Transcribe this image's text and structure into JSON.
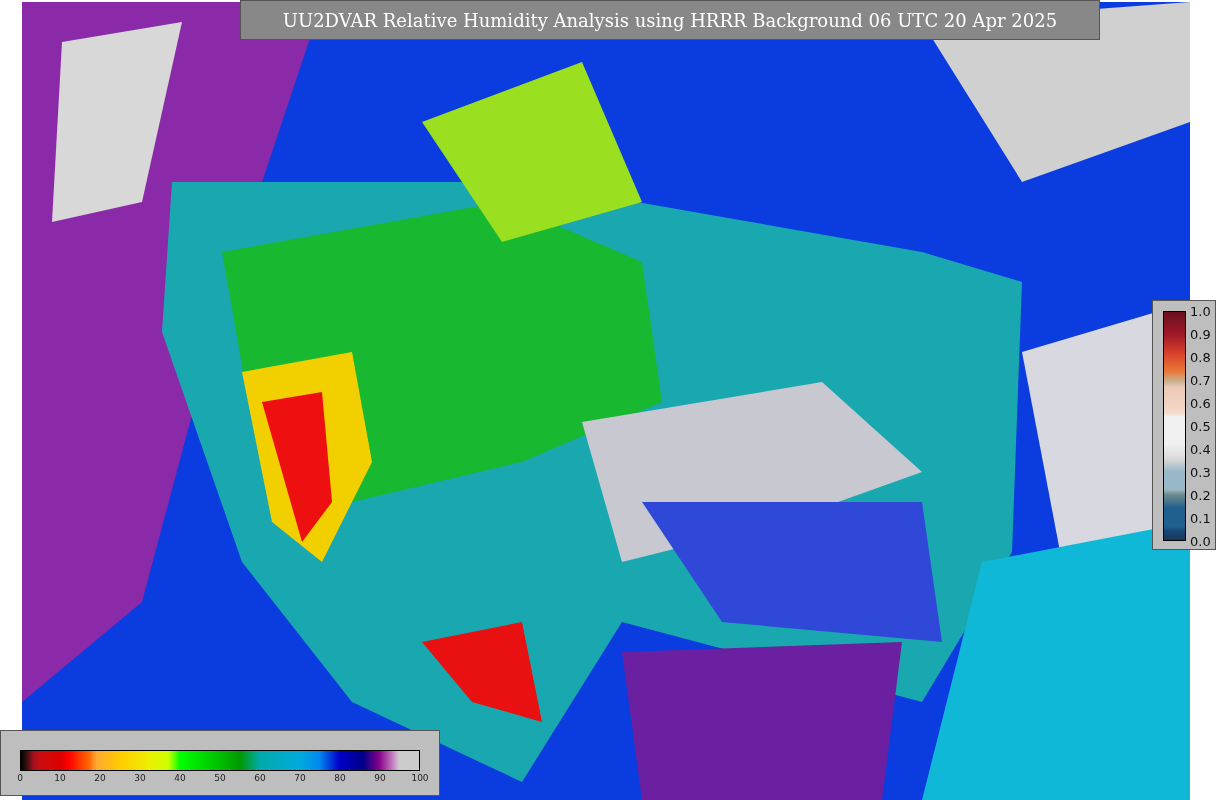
{
  "title": "UU2DVAR Relative Humidity Analysis using HRRR Background 06 UTC 20 Apr 2025",
  "bottom_legend": {
    "ticks": [
      "0",
      "10",
      "20",
      "30",
      "40",
      "50",
      "60",
      "70",
      "80",
      "90",
      "100"
    ]
  },
  "side_legend": {
    "ticks": [
      "1.0",
      "0.9",
      "0.8",
      "0.7",
      "0.6",
      "0.5",
      "0.4",
      "0.3",
      "0.2",
      "0.1",
      "0.0"
    ]
  }
}
